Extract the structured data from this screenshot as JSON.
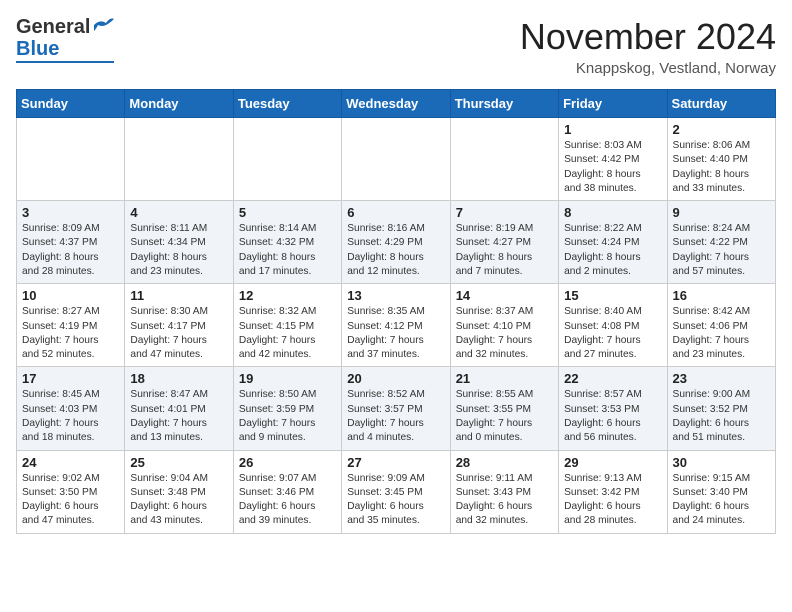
{
  "header": {
    "logo_line1": "General",
    "logo_line2": "Blue",
    "month": "November 2024",
    "location": "Knappskog, Vestland, Norway"
  },
  "weekdays": [
    "Sunday",
    "Monday",
    "Tuesday",
    "Wednesday",
    "Thursday",
    "Friday",
    "Saturday"
  ],
  "weeks": [
    [
      {
        "day": "",
        "info": ""
      },
      {
        "day": "",
        "info": ""
      },
      {
        "day": "",
        "info": ""
      },
      {
        "day": "",
        "info": ""
      },
      {
        "day": "",
        "info": ""
      },
      {
        "day": "1",
        "info": "Sunrise: 8:03 AM\nSunset: 4:42 PM\nDaylight: 8 hours\nand 38 minutes."
      },
      {
        "day": "2",
        "info": "Sunrise: 8:06 AM\nSunset: 4:40 PM\nDaylight: 8 hours\nand 33 minutes."
      }
    ],
    [
      {
        "day": "3",
        "info": "Sunrise: 8:09 AM\nSunset: 4:37 PM\nDaylight: 8 hours\nand 28 minutes."
      },
      {
        "day": "4",
        "info": "Sunrise: 8:11 AM\nSunset: 4:34 PM\nDaylight: 8 hours\nand 23 minutes."
      },
      {
        "day": "5",
        "info": "Sunrise: 8:14 AM\nSunset: 4:32 PM\nDaylight: 8 hours\nand 17 minutes."
      },
      {
        "day": "6",
        "info": "Sunrise: 8:16 AM\nSunset: 4:29 PM\nDaylight: 8 hours\nand 12 minutes."
      },
      {
        "day": "7",
        "info": "Sunrise: 8:19 AM\nSunset: 4:27 PM\nDaylight: 8 hours\nand 7 minutes."
      },
      {
        "day": "8",
        "info": "Sunrise: 8:22 AM\nSunset: 4:24 PM\nDaylight: 8 hours\nand 2 minutes."
      },
      {
        "day": "9",
        "info": "Sunrise: 8:24 AM\nSunset: 4:22 PM\nDaylight: 7 hours\nand 57 minutes."
      }
    ],
    [
      {
        "day": "10",
        "info": "Sunrise: 8:27 AM\nSunset: 4:19 PM\nDaylight: 7 hours\nand 52 minutes."
      },
      {
        "day": "11",
        "info": "Sunrise: 8:30 AM\nSunset: 4:17 PM\nDaylight: 7 hours\nand 47 minutes."
      },
      {
        "day": "12",
        "info": "Sunrise: 8:32 AM\nSunset: 4:15 PM\nDaylight: 7 hours\nand 42 minutes."
      },
      {
        "day": "13",
        "info": "Sunrise: 8:35 AM\nSunset: 4:12 PM\nDaylight: 7 hours\nand 37 minutes."
      },
      {
        "day": "14",
        "info": "Sunrise: 8:37 AM\nSunset: 4:10 PM\nDaylight: 7 hours\nand 32 minutes."
      },
      {
        "day": "15",
        "info": "Sunrise: 8:40 AM\nSunset: 4:08 PM\nDaylight: 7 hours\nand 27 minutes."
      },
      {
        "day": "16",
        "info": "Sunrise: 8:42 AM\nSunset: 4:06 PM\nDaylight: 7 hours\nand 23 minutes."
      }
    ],
    [
      {
        "day": "17",
        "info": "Sunrise: 8:45 AM\nSunset: 4:03 PM\nDaylight: 7 hours\nand 18 minutes."
      },
      {
        "day": "18",
        "info": "Sunrise: 8:47 AM\nSunset: 4:01 PM\nDaylight: 7 hours\nand 13 minutes."
      },
      {
        "day": "19",
        "info": "Sunrise: 8:50 AM\nSunset: 3:59 PM\nDaylight: 7 hours\nand 9 minutes."
      },
      {
        "day": "20",
        "info": "Sunrise: 8:52 AM\nSunset: 3:57 PM\nDaylight: 7 hours\nand 4 minutes."
      },
      {
        "day": "21",
        "info": "Sunrise: 8:55 AM\nSunset: 3:55 PM\nDaylight: 7 hours\nand 0 minutes."
      },
      {
        "day": "22",
        "info": "Sunrise: 8:57 AM\nSunset: 3:53 PM\nDaylight: 6 hours\nand 56 minutes."
      },
      {
        "day": "23",
        "info": "Sunrise: 9:00 AM\nSunset: 3:52 PM\nDaylight: 6 hours\nand 51 minutes."
      }
    ],
    [
      {
        "day": "24",
        "info": "Sunrise: 9:02 AM\nSunset: 3:50 PM\nDaylight: 6 hours\nand 47 minutes."
      },
      {
        "day": "25",
        "info": "Sunrise: 9:04 AM\nSunset: 3:48 PM\nDaylight: 6 hours\nand 43 minutes."
      },
      {
        "day": "26",
        "info": "Sunrise: 9:07 AM\nSunset: 3:46 PM\nDaylight: 6 hours\nand 39 minutes."
      },
      {
        "day": "27",
        "info": "Sunrise: 9:09 AM\nSunset: 3:45 PM\nDaylight: 6 hours\nand 35 minutes."
      },
      {
        "day": "28",
        "info": "Sunrise: 9:11 AM\nSunset: 3:43 PM\nDaylight: 6 hours\nand 32 minutes."
      },
      {
        "day": "29",
        "info": "Sunrise: 9:13 AM\nSunset: 3:42 PM\nDaylight: 6 hours\nand 28 minutes."
      },
      {
        "day": "30",
        "info": "Sunrise: 9:15 AM\nSunset: 3:40 PM\nDaylight: 6 hours\nand 24 minutes."
      }
    ]
  ]
}
